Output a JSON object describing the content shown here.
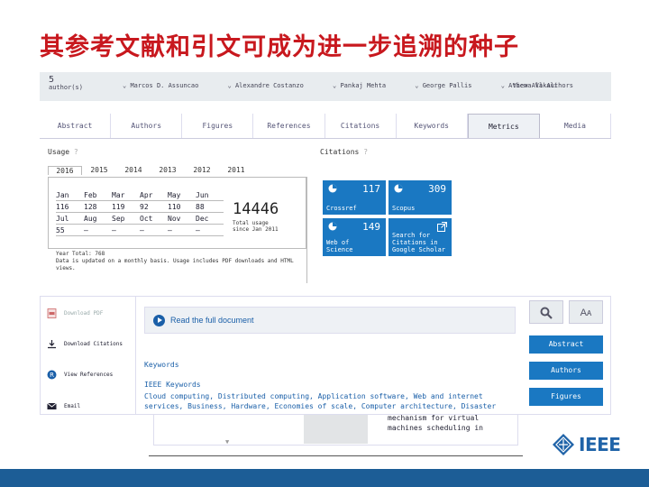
{
  "slide": {
    "title": "其参考文献和引文可成为进一步追溯的种子"
  },
  "authors_bar": {
    "count_num": "5",
    "count_label": "author(s)",
    "names": [
      "Marcos D. Assuncao",
      "Alexandre Costanzo",
      "Pankaj Mehta",
      "George Pallis",
      "Athena Vakali"
    ],
    "view_all": "View All Authors"
  },
  "tabs": [
    "Abstract",
    "Authors",
    "Figures",
    "References",
    "Citations",
    "Keywords",
    "Metrics",
    "Media"
  ],
  "usage": {
    "title": "Usage",
    "years": [
      "2016",
      "2015",
      "2014",
      "2013",
      "2012",
      "2011"
    ],
    "months_row1": [
      "Jan",
      "Feb",
      "Mar",
      "Apr",
      "May",
      "Jun"
    ],
    "values_row1": [
      "116",
      "128",
      "119",
      "92",
      "110",
      "88"
    ],
    "months_row2": [
      "Jul",
      "Aug",
      "Sep",
      "Oct",
      "Nov",
      "Dec"
    ],
    "values_row2": [
      "55",
      "–",
      "–",
      "–",
      "–",
      "–"
    ],
    "total": "14446",
    "total_label": "Total usage since Jan 2011",
    "year_total_label": "Year Total: 768",
    "note": "Data is updated on a monthly basis. Usage includes PDF downloads and HTML views."
  },
  "citations": {
    "title": "Citations",
    "crossref": {
      "label": "Crossref",
      "value": "117"
    },
    "scopus": {
      "label": "Scopus",
      "value": "309"
    },
    "wos": {
      "label": "Web of Science",
      "value": "149"
    },
    "search": {
      "label": "Search for Citations in Google Scholar"
    }
  },
  "sidebar": {
    "download_pdf": "Download PDF",
    "download_citations": "Download Citations",
    "view_references": "View References",
    "email": "Email"
  },
  "main": {
    "read_full": "Read the full document",
    "keywords_heading": "Keywords",
    "ieee_keywords": "IEEE Keywords",
    "keywords_text": "Cloud computing, Distributed computing, Application software, Web and internet services, Business, Hardware, Economies of scale, Computer architecture, Disaster",
    "overflow_text": "mechanism for virtual machines scheduling in"
  },
  "right_tools": {
    "search_icon": "search-icon",
    "text_size_label": "Aᴀ",
    "nav": [
      "Abstract",
      "Authors",
      "Figures"
    ]
  },
  "logo": {
    "text": "IEEE"
  },
  "colors": {
    "title_red": "#c8181e",
    "accent_blue": "#1a78c2",
    "band_blue": "#1c5d96"
  }
}
